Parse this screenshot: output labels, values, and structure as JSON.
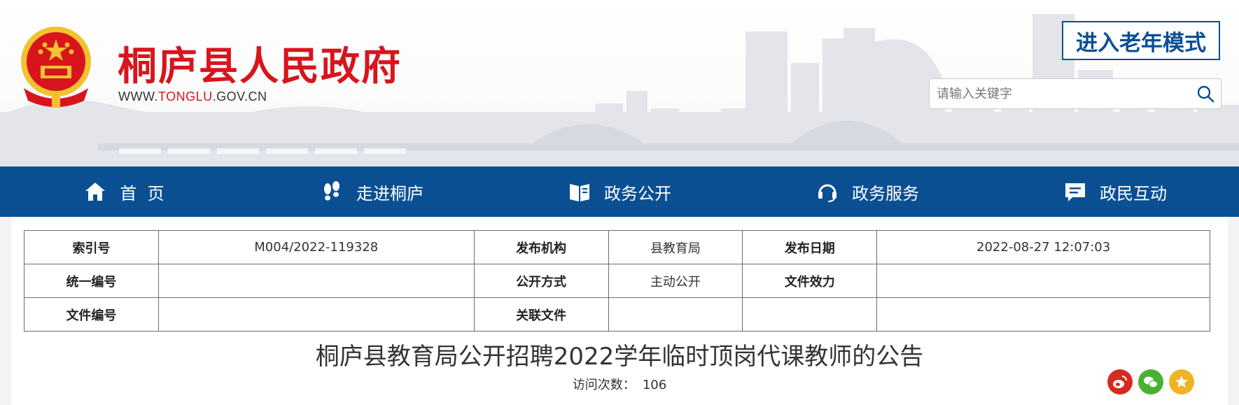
{
  "site": {
    "title": "桐庐县人民政府",
    "url_prefix": "WWW.",
    "url_highlight": "TONGLU",
    "url_suffix": ".GOV.CN"
  },
  "header": {
    "elder_mode_label": "进入老年模式",
    "search_placeholder": "请输入关键字"
  },
  "nav": [
    {
      "label": "首  页",
      "icon": "home-icon"
    },
    {
      "label": "走进桐庐",
      "icon": "footprints-icon"
    },
    {
      "label": "政务公开",
      "icon": "book-icon"
    },
    {
      "label": "政务服务",
      "icon": "headset-icon"
    },
    {
      "label": "政民互动",
      "icon": "message-icon"
    }
  ],
  "meta": {
    "index_no_label": "索引号",
    "index_no": "M004/2022-119328",
    "publisher_label": "发布机构",
    "publisher": "县教育局",
    "date_label": "发布日期",
    "date": "2022-08-27 12:07:03",
    "unified_no_label": "统一编号",
    "unified_no": "",
    "disclosure_label": "公开方式",
    "disclosure": "主动公开",
    "validity_label": "文件效力",
    "validity": "",
    "file_no_label": "文件编号",
    "file_no": "",
    "related_label": "关联文件",
    "related": ""
  },
  "article": {
    "title": "桐庐县教育局公开招聘2022学年临时顶岗代课教师的公告",
    "visits_label": "访问次数：",
    "visits": "106"
  },
  "colors": {
    "brand_red": "#d8151c",
    "nav_blue": "#0a4f92",
    "weibo": "#d52b1e",
    "wechat": "#49b233",
    "favorite": "#f0b324"
  }
}
